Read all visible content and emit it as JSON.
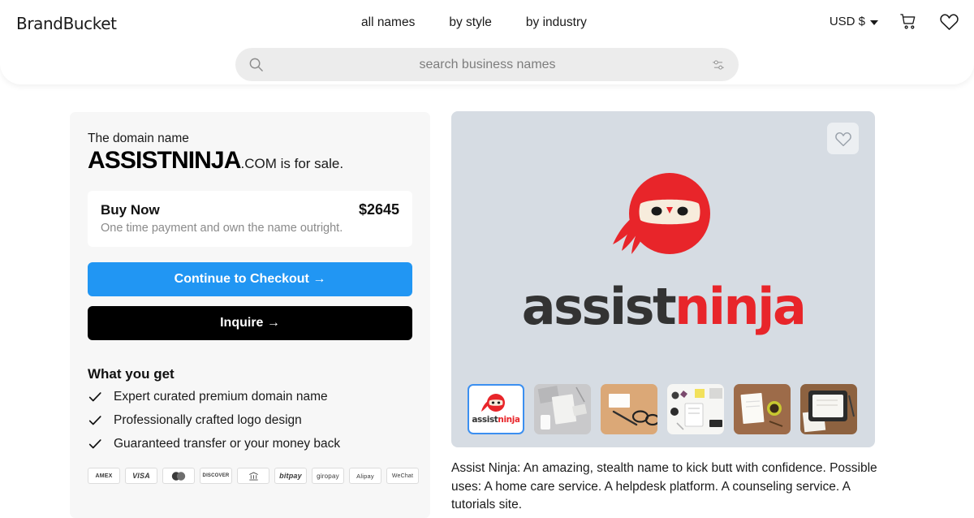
{
  "header": {
    "logo": "BrandBucket",
    "nav": [
      {
        "label": "all names",
        "name": "nav-all-names"
      },
      {
        "label": "by style",
        "name": "nav-by-style"
      },
      {
        "label": "by industry",
        "name": "nav-by-industry"
      }
    ],
    "currency": "USD $",
    "cart_icon": "cart-icon",
    "wishlist_icon": "heart-icon"
  },
  "search": {
    "placeholder": "search business names",
    "value": "",
    "search_icon": "search-icon",
    "filter_icon": "sliders-filter-icon"
  },
  "offer": {
    "pre_text": "The domain name",
    "domain_name": "ASSISTNINJA",
    "domain_tld_text": ".COM is for sale.",
    "buy_now_label": "Buy Now",
    "price": "$2645",
    "price_note": "One time payment and own the name outright.",
    "checkout_label": "Continue to Checkout →",
    "inquire_label": "Inquire →",
    "accent_blue": "#2196f3",
    "inquire_bg": "#000000"
  },
  "what_you_get": {
    "title": "What you get",
    "items": [
      "Expert curated premium domain name",
      "Professionally crafted logo design",
      "Guaranteed transfer or your money back"
    ]
  },
  "payments": [
    "AMEX",
    "VISA",
    "mastercard",
    "DISCOVER",
    "bank",
    "bitpay",
    "giropay",
    "Alipay",
    "WeChat"
  ],
  "logo_panel": {
    "background": "#d6dce3",
    "favorite_icon": "heart-outline-icon",
    "wordmark_first": "assist",
    "wordmark_second": "ninja",
    "wordmark_first_color": "#333333",
    "wordmark_second_color": "#e8252a",
    "ninja_red": "#e8252a",
    "mask_color": "#f7ecdc",
    "thumbnails": [
      {
        "name": "thumbnail-logo",
        "label": "assistninja",
        "selected": true
      },
      {
        "name": "thumbnail-mockup-1",
        "label": "",
        "selected": false
      },
      {
        "name": "thumbnail-mockup-2",
        "label": "",
        "selected": false
      },
      {
        "name": "thumbnail-mockup-3",
        "label": "",
        "selected": false
      },
      {
        "name": "thumbnail-mockup-4",
        "label": "",
        "selected": false
      },
      {
        "name": "thumbnail-mockup-5",
        "label": "",
        "selected": false
      }
    ]
  },
  "description": "Assist Ninja: An amazing, stealth name to kick butt with confidence. Possible uses: A home care service. A helpdesk platform. A counseling service. A tutorials site."
}
